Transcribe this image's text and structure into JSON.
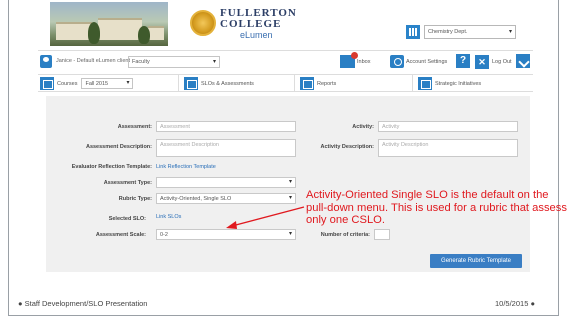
{
  "header": {
    "logo_line1": "FULLERTON",
    "logo_line2": "COLLEGE",
    "logo_line3": "eLumen",
    "department_select": "Chemistry Dept."
  },
  "userbar": {
    "user_name": "Janice - Default eLumen client",
    "role_select": "Faculty",
    "inbox_label": "Inbox",
    "account_settings_label": "Account Settings",
    "help_label": "?",
    "logout_label": "Log Out"
  },
  "nav": {
    "courses_label": "Courses",
    "term_select": "Fall 2015",
    "slos_label": "SLOs & Assessments",
    "reports_label": "Reports",
    "strategic_label": "Strategic Initiatives"
  },
  "form": {
    "assessment_label": "Assessment:",
    "assessment_placeholder": "Assessment",
    "assessment_description_label": "Assessment Description:",
    "assessment_description_placeholder": "Assessment Description",
    "activity_label": "Activity:",
    "activity_placeholder": "Activity",
    "activity_description_label": "Activity Description:",
    "activity_description_placeholder": "Activity Description",
    "evaluator_template_label": "Evaluator Reflection Template:",
    "evaluator_template_link": "Link Reflection Template",
    "assessment_type_label": "Assessment Type:",
    "assessment_type_value": "",
    "rubric_type_label": "Rubric Type:",
    "rubric_type_value": "Activity-Oriented, Single SLO",
    "selected_slo_label": "Selected SLO:",
    "selected_slo_link": "Link SLOs",
    "assessment_scale_label": "Assessment Scale:",
    "assessment_scale_value": "0-2",
    "number_of_criteria_label": "Number of criteria:",
    "generate_button": "Generate Rubric Template"
  },
  "annotation": {
    "text": "Activity-Oriented Single SLO is the default on the pull-down menu.   This is used for a rubric that assess only one CSLO.",
    "color": "#e0191f"
  },
  "footer": {
    "left": "Staff Development/SLO Presentation",
    "right": "10/5/2015"
  },
  "colors": {
    "accent": "#2a7fc4",
    "button": "#3a7ec4",
    "link": "#2a6fb8"
  }
}
